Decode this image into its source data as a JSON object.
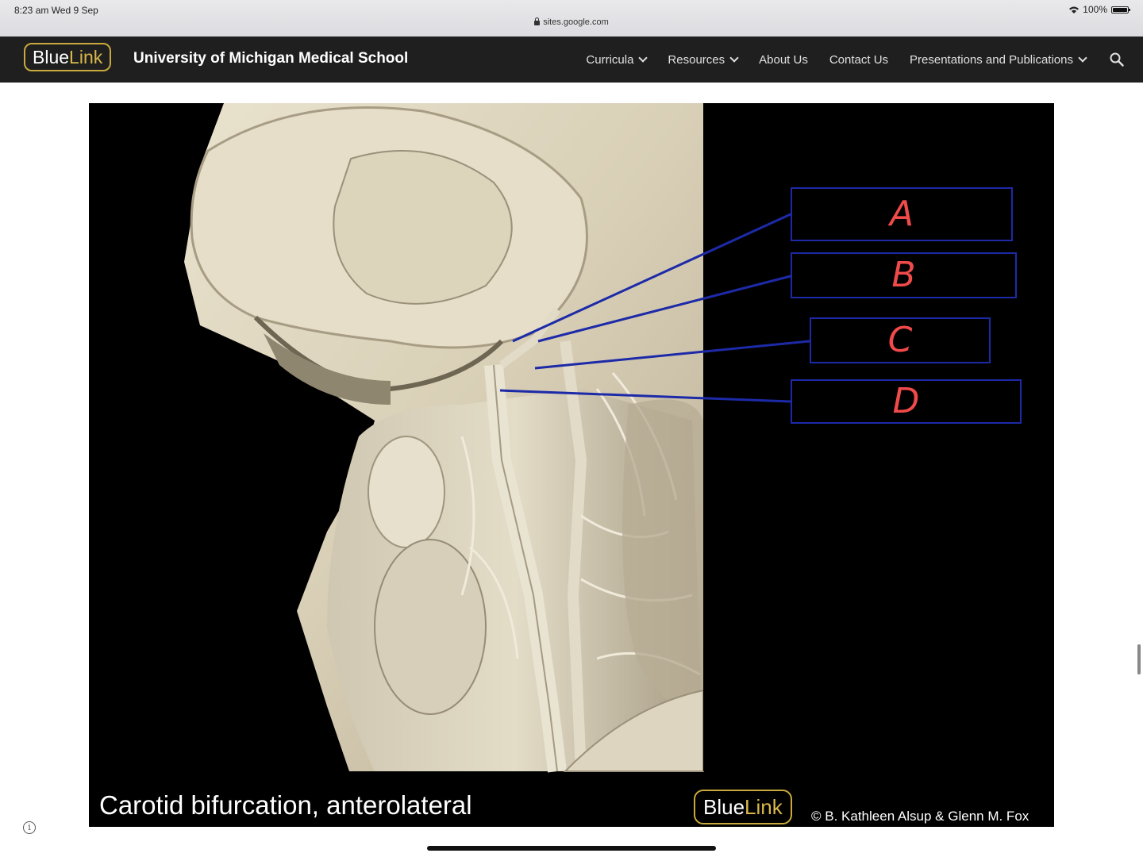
{
  "status_bar": {
    "time": "8:23 am   Wed 9 Sep",
    "url": "sites.google.com",
    "battery": "100%"
  },
  "header": {
    "logo": {
      "part1": "Blue",
      "part2": "Link"
    },
    "site_title": "University of Michigan Medical School",
    "nav": [
      {
        "label": "Curricula",
        "has_dropdown": true
      },
      {
        "label": "Resources",
        "has_dropdown": true
      },
      {
        "label": "About Us",
        "has_dropdown": false
      },
      {
        "label": "Contact Us",
        "has_dropdown": false
      },
      {
        "label": "Presentations and Publications",
        "has_dropdown": true
      }
    ],
    "search_icon": "search-icon"
  },
  "slide": {
    "labels": [
      "A",
      "B",
      "C",
      "D"
    ],
    "caption": "Carotid bifurcation, anterolateral",
    "logo": {
      "part1": "Blue",
      "part2": "Link"
    },
    "copyright": "© B. Kathleen Alsup & Glenn M. Fox",
    "colors": {
      "label_box": "#1d2aa8",
      "label_text": "#f04a4a",
      "background": "#000000"
    }
  },
  "colors": {
    "header_bg": "#1f1f1f",
    "logo_gold": "#c9a93d"
  }
}
